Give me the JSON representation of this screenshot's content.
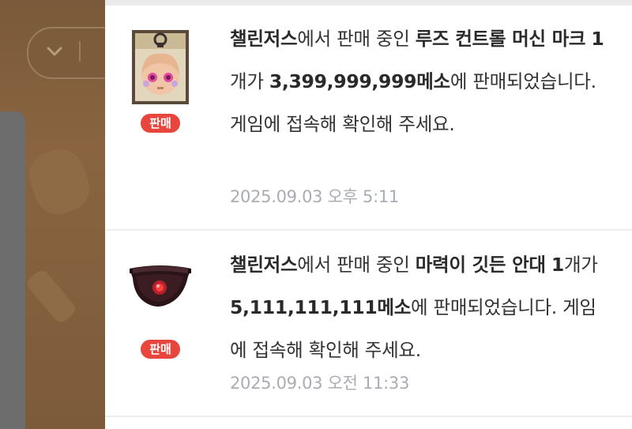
{
  "background": {
    "dropdown_icon": "chevron-down-icon"
  },
  "notifications": [
    {
      "badge": "판매",
      "item_image": "rose-control-machine-mark-item",
      "seller": "챌린저스",
      "text1": "에서 판매 중인 ",
      "item_name": "루즈 컨트롤 머신 마크",
      "quantity": "1",
      "text2": "개가 ",
      "price": "3,399,999,999메소",
      "text3": "에 판매되었습니다. 게임에 접속해 확인해 주세요.",
      "timestamp": "2025.09.03 오후 5:11"
    },
    {
      "badge": "판매",
      "item_image": "magic-eye-patch-item",
      "seller": "챌린저스",
      "text1": "에서 판매 중인 ",
      "item_name": "마력이 깃든 안대",
      "quantity": "1",
      "text2": "개가 ",
      "price": "5,111,111,111메소",
      "text3": "에 판매되었습니다. 게임에 접속해 확인해 주세요.",
      "timestamp": "2025.09.03 오전 11:33"
    }
  ],
  "colors": {
    "badge": "#e8453c",
    "timestamp": "#a9adb3",
    "overlay_background": "#7a5a3a"
  }
}
